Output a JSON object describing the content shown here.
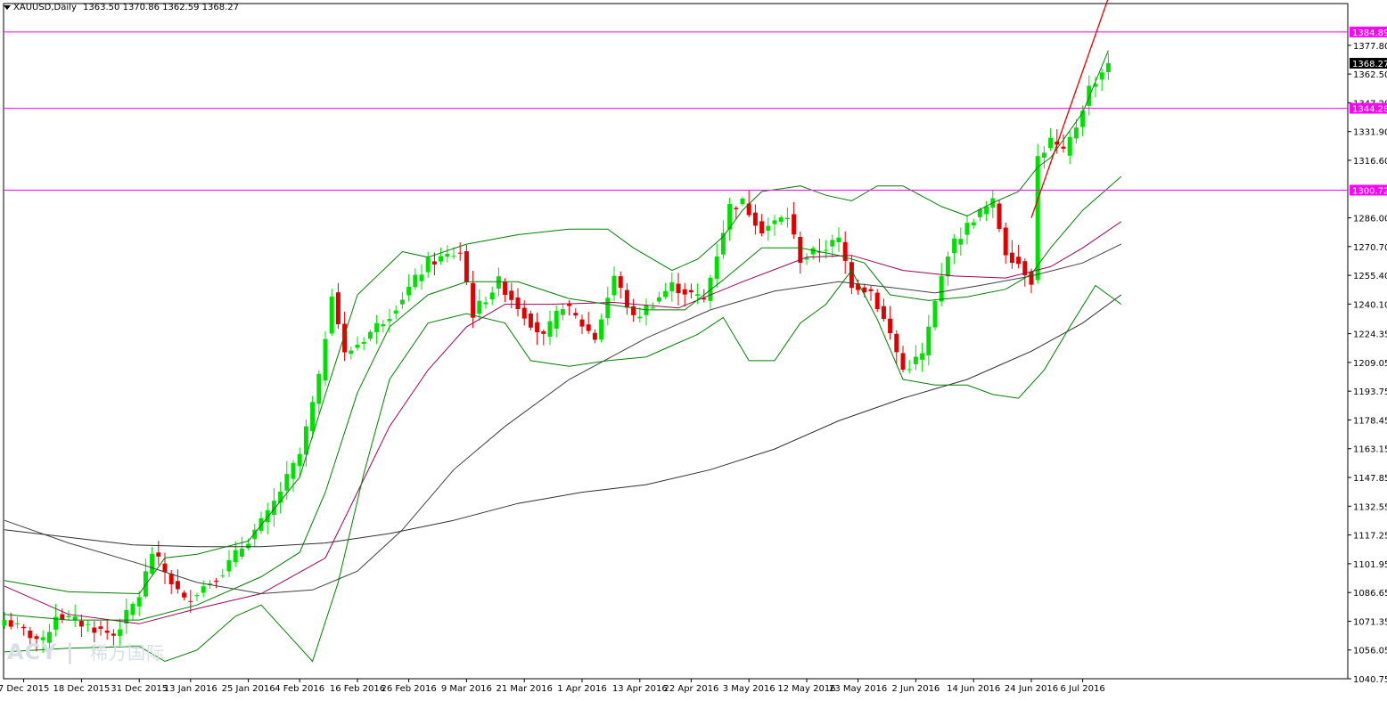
{
  "header": {
    "symbol": "XAUUSD,Daily",
    "ohlc": "1363.50 1370.86 1362.59 1368.27"
  },
  "watermark": {
    "brand": "ACY",
    "separator": "|",
    "cn": "稀万国际"
  },
  "colors": {
    "bull": "#00e000",
    "bear": "#e00000",
    "hline": "#ff00ff",
    "bollinger": "#008000",
    "ma_fast": "#a0005a",
    "ma_mid": "#404040",
    "ma_slow": "#303030",
    "trend": "#e00000",
    "current": "#000000"
  },
  "chart_data": {
    "type": "candlestick",
    "y_range": [
      1040.75,
      1400.0
    ],
    "y_ticks": [
      1377.8,
      1362.5,
      1347.2,
      1331.9,
      1316.6,
      1286.0,
      1270.7,
      1255.4,
      1240.1,
      1224.35,
      1209.05,
      1193.75,
      1178.45,
      1163.15,
      1147.85,
      1132.55,
      1117.25,
      1101.95,
      1086.65,
      1071.35,
      1056.05,
      1040.75
    ],
    "y_tick_labels": [
      "1377.80",
      "1362.50",
      "1347.20",
      "1331.90",
      "1316.60",
      "1286.00",
      "1270.70",
      "1255.40",
      "1240.10",
      "1224.35",
      "1209.05",
      "1193.75",
      "1178.45",
      "1163.15",
      "1147.85",
      "1132.55",
      "1117.25",
      "1101.95",
      "1086.65",
      "1071.35",
      "1056.05",
      "1040.75"
    ],
    "x_labels": [
      {
        "label": "7 Dec 2015",
        "index": 3
      },
      {
        "label": "18 Dec 2015",
        "index": 12
      },
      {
        "label": "31 Dec 2015",
        "index": 21
      },
      {
        "label": "13 Jan 2016",
        "index": 29
      },
      {
        "label": "25 Jan 2016",
        "index": 38
      },
      {
        "label": "4 Feb 2016",
        "index": 46
      },
      {
        "label": "16 Feb 2016",
        "index": 55
      },
      {
        "label": "26 Feb 2016",
        "index": 63
      },
      {
        "label": "9 Mar 2016",
        "index": 72
      },
      {
        "label": "21 Mar 2016",
        "index": 81
      },
      {
        "label": "1 Apr 2016",
        "index": 90
      },
      {
        "label": "13 Apr 2016",
        "index": 99
      },
      {
        "label": "22 Apr 2016",
        "index": 107
      },
      {
        "label": "3 May 2016",
        "index": 116
      },
      {
        "label": "12 May 2016",
        "index": 125
      },
      {
        "label": "23 May 2016",
        "index": 133
      },
      {
        "label": "2 Jun 2016",
        "index": 142
      },
      {
        "label": "14 Jun 2016",
        "index": 151
      },
      {
        "label": "24 Jun 2016",
        "index": 160
      },
      {
        "label": "6 Jul 2016",
        "index": 168
      }
    ],
    "horizontal_levels": [
      {
        "value": 1384.89,
        "label": "1384.89"
      },
      {
        "value": 1344.28,
        "label": "1344.28"
      },
      {
        "value": 1300.72,
        "label": "1300.72"
      }
    ],
    "current_price": {
      "value": 1368.27,
      "label": "1368.27"
    },
    "trendline": [
      {
        "index": 160,
        "value": 1286.0
      },
      {
        "index": 172,
        "value": 1403.0
      }
    ],
    "key_points": [
      {
        "index": 0,
        "close": 1072
      },
      {
        "index": 6,
        "close": 1060
      },
      {
        "index": 8,
        "close": 1075
      },
      {
        "index": 17,
        "close": 1064
      },
      {
        "index": 21,
        "close": 1085
      },
      {
        "index": 23,
        "close": 1108
      },
      {
        "index": 28,
        "close": 1082
      },
      {
        "index": 34,
        "close": 1098
      },
      {
        "index": 41,
        "close": 1128
      },
      {
        "index": 46,
        "close": 1160
      },
      {
        "index": 49,
        "close": 1200
      },
      {
        "index": 51,
        "close": 1247
      },
      {
        "index": 53,
        "close": 1213
      },
      {
        "index": 56,
        "close": 1222
      },
      {
        "index": 60,
        "close": 1235
      },
      {
        "index": 66,
        "close": 1262
      },
      {
        "index": 71,
        "close": 1268
      },
      {
        "index": 73,
        "close": 1235
      },
      {
        "index": 77,
        "close": 1252
      },
      {
        "index": 84,
        "close": 1222
      },
      {
        "index": 87,
        "close": 1240
      },
      {
        "index": 92,
        "close": 1222
      },
      {
        "index": 95,
        "close": 1255
      },
      {
        "index": 98,
        "close": 1232
      },
      {
        "index": 104,
        "close": 1250
      },
      {
        "index": 109,
        "close": 1242
      },
      {
        "index": 113,
        "close": 1292
      },
      {
        "index": 115,
        "close": 1294
      },
      {
        "index": 118,
        "close": 1280
      },
      {
        "index": 122,
        "close": 1287
      },
      {
        "index": 124,
        "close": 1264
      },
      {
        "index": 130,
        "close": 1274
      },
      {
        "index": 132,
        "close": 1251
      },
      {
        "index": 135,
        "close": 1247
      },
      {
        "index": 138,
        "close": 1224
      },
      {
        "index": 140,
        "close": 1205
      },
      {
        "index": 143,
        "close": 1213
      },
      {
        "index": 147,
        "close": 1268
      },
      {
        "index": 151,
        "close": 1286
      },
      {
        "index": 154,
        "close": 1294
      },
      {
        "index": 156,
        "close": 1268
      },
      {
        "index": 158,
        "close": 1262
      },
      {
        "index": 160,
        "close": 1253
      },
      {
        "index": 161,
        "close": 1318
      },
      {
        "index": 163,
        "close": 1327
      },
      {
        "index": 165,
        "close": 1320
      },
      {
        "index": 167,
        "close": 1335
      },
      {
        "index": 169,
        "close": 1355
      },
      {
        "index": 172,
        "close": 1368.27
      }
    ],
    "series": [
      {
        "key": "ma_fast",
        "points": [
          [
            0,
            1090
          ],
          [
            10,
            1075
          ],
          [
            21,
            1070
          ],
          [
            30,
            1078
          ],
          [
            40,
            1086
          ],
          [
            50,
            1105
          ],
          [
            55,
            1140
          ],
          [
            60,
            1175
          ],
          [
            66,
            1205
          ],
          [
            72,
            1228
          ],
          [
            78,
            1240
          ],
          [
            85,
            1240
          ],
          [
            95,
            1241
          ],
          [
            105,
            1238
          ],
          [
            115,
            1252
          ],
          [
            125,
            1265
          ],
          [
            132,
            1266
          ],
          [
            140,
            1258
          ],
          [
            148,
            1255
          ],
          [
            156,
            1254
          ],
          [
            163,
            1260
          ],
          [
            168,
            1270
          ],
          [
            174,
            1284
          ]
        ]
      },
      {
        "key": "ma_mid",
        "points": [
          [
            0,
            1125
          ],
          [
            10,
            1113
          ],
          [
            21,
            1102
          ],
          [
            30,
            1092
          ],
          [
            40,
            1086
          ],
          [
            48,
            1088
          ],
          [
            55,
            1098
          ],
          [
            62,
            1120
          ],
          [
            70,
            1152
          ],
          [
            78,
            1175
          ],
          [
            88,
            1200
          ],
          [
            100,
            1222
          ],
          [
            110,
            1237
          ],
          [
            120,
            1247
          ],
          [
            130,
            1252
          ],
          [
            138,
            1249
          ],
          [
            145,
            1246
          ],
          [
            152,
            1250
          ],
          [
            160,
            1255
          ],
          [
            168,
            1262
          ],
          [
            174,
            1272
          ]
        ]
      },
      {
        "key": "ma_slow",
        "points": [
          [
            0,
            1120
          ],
          [
            10,
            1116
          ],
          [
            20,
            1112
          ],
          [
            30,
            1111
          ],
          [
            40,
            1111
          ],
          [
            50,
            1113
          ],
          [
            60,
            1118
          ],
          [
            70,
            1125
          ],
          [
            80,
            1134
          ],
          [
            90,
            1140
          ],
          [
            100,
            1144
          ],
          [
            110,
            1152
          ],
          [
            120,
            1163
          ],
          [
            130,
            1178
          ],
          [
            140,
            1190
          ],
          [
            150,
            1200
          ],
          [
            160,
            1215
          ],
          [
            168,
            1230
          ],
          [
            174,
            1245
          ]
        ]
      },
      {
        "key": "bb_upper",
        "points": [
          [
            0,
            1093
          ],
          [
            10,
            1087
          ],
          [
            21,
            1086
          ],
          [
            25,
            1105
          ],
          [
            30,
            1107
          ],
          [
            38,
            1114
          ],
          [
            46,
            1148
          ],
          [
            50,
            1192
          ],
          [
            55,
            1245
          ],
          [
            62,
            1268
          ],
          [
            66,
            1265
          ],
          [
            72,
            1272
          ],
          [
            80,
            1277
          ],
          [
            88,
            1280
          ],
          [
            94,
            1280
          ],
          [
            98,
            1270
          ],
          [
            104,
            1258
          ],
          [
            108,
            1264
          ],
          [
            112,
            1276
          ],
          [
            115,
            1290
          ],
          [
            118,
            1300
          ],
          [
            124,
            1303
          ],
          [
            128,
            1298
          ],
          [
            132,
            1295
          ],
          [
            136,
            1303
          ],
          [
            140,
            1303
          ],
          [
            146,
            1292
          ],
          [
            150,
            1287
          ],
          [
            154,
            1294
          ],
          [
            158,
            1300
          ],
          [
            161,
            1313
          ],
          [
            163,
            1318
          ],
          [
            168,
            1342
          ],
          [
            172,
            1375
          ]
        ]
      },
      {
        "key": "bb_lower",
        "points": [
          [
            0,
            1055
          ],
          [
            10,
            1057
          ],
          [
            21,
            1058
          ],
          [
            25,
            1050
          ],
          [
            30,
            1056
          ],
          [
            36,
            1074
          ],
          [
            40,
            1080
          ],
          [
            44,
            1065
          ],
          [
            48,
            1050
          ],
          [
            52,
            1092
          ],
          [
            56,
            1150
          ],
          [
            60,
            1200
          ],
          [
            66,
            1230
          ],
          [
            72,
            1235
          ],
          [
            78,
            1230
          ],
          [
            82,
            1210
          ],
          [
            88,
            1207
          ],
          [
            94,
            1210
          ],
          [
            100,
            1212
          ],
          [
            104,
            1218
          ],
          [
            108,
            1224
          ],
          [
            112,
            1233
          ],
          [
            116,
            1210
          ],
          [
            120,
            1210
          ],
          [
            124,
            1230
          ],
          [
            128,
            1240
          ],
          [
            132,
            1258
          ],
          [
            136,
            1232
          ],
          [
            140,
            1200
          ],
          [
            145,
            1197
          ],
          [
            150,
            1197
          ],
          [
            154,
            1192
          ],
          [
            158,
            1190
          ],
          [
            162,
            1205
          ],
          [
            166,
            1228
          ],
          [
            170,
            1250
          ],
          [
            174,
            1240
          ]
        ]
      },
      {
        "key": "bb_mid",
        "points": [
          [
            0,
            1075
          ],
          [
            10,
            1072
          ],
          [
            21,
            1072
          ],
          [
            30,
            1080
          ],
          [
            40,
            1095
          ],
          [
            46,
            1108
          ],
          [
            50,
            1140
          ],
          [
            55,
            1193
          ],
          [
            60,
            1228
          ],
          [
            66,
            1245
          ],
          [
            72,
            1252
          ],
          [
            80,
            1252
          ],
          [
            88,
            1243
          ],
          [
            94,
            1240
          ],
          [
            100,
            1237
          ],
          [
            106,
            1237
          ],
          [
            112,
            1253
          ],
          [
            118,
            1270
          ],
          [
            124,
            1270
          ],
          [
            130,
            1266
          ],
          [
            134,
            1262
          ],
          [
            138,
            1245
          ],
          [
            144,
            1242
          ],
          [
            150,
            1244
          ],
          [
            156,
            1248
          ],
          [
            160,
            1256
          ],
          [
            163,
            1270
          ],
          [
            168,
            1290
          ],
          [
            174,
            1308
          ]
        ]
      }
    ]
  }
}
